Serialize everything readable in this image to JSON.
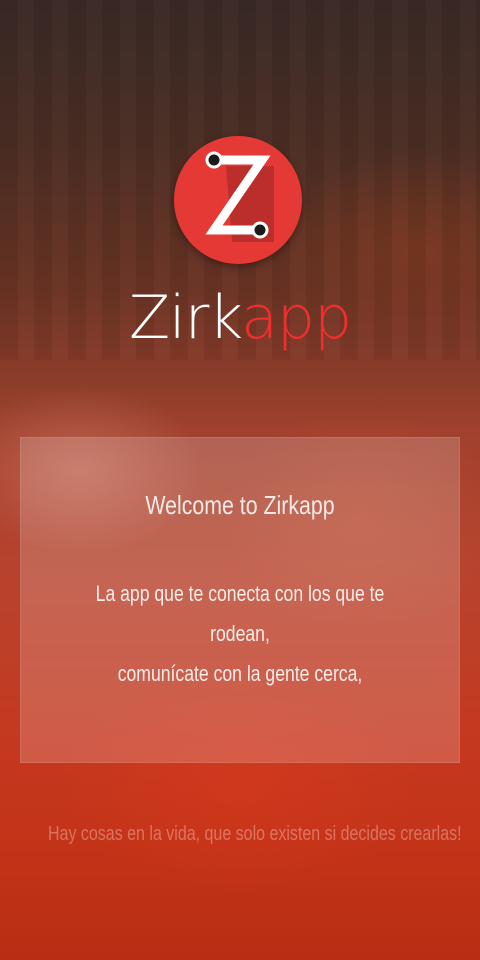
{
  "brand": {
    "name_part1": "Zirk",
    "name_part2": "app",
    "logo_letter": "Z",
    "colors": {
      "logo_red": "#e53935",
      "app_red": "#ef2e2e",
      "white": "#ffffff"
    },
    "logo_icon": "zirkapp-z-logo-icon"
  },
  "card": {
    "title": "Welcome to Zirkapp",
    "line1": "La app que te conecta con los que te rodean,",
    "line2": "comunícate con la gente cerca,"
  },
  "footer": {
    "tagline": "Hay cosas en la vida, que solo existen si decides crearlas!"
  }
}
